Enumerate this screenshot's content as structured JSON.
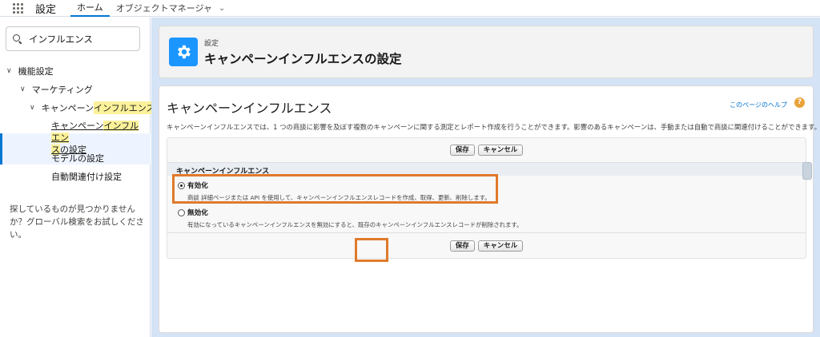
{
  "topbar": {
    "app_name": "設定",
    "tabs": [
      {
        "label": "ホーム"
      },
      {
        "label": "オブジェクトマネージャ"
      }
    ]
  },
  "sidebar": {
    "search_value": "インフルエンス",
    "tree": {
      "root": "機能設定",
      "marketing": "マーケティング",
      "campaign_influence_prefix": "キャンペーン",
      "campaign_influence_hl": "インフルエンス",
      "selected_prefix": "キャンペーン",
      "selected_hl1": "インフルエン",
      "selected_hl2": "ス",
      "selected_suffix": "の設定",
      "model_settings": "モデルの設定",
      "auto_link": "自動関連付け設定"
    },
    "help_text": "探しているものが見つかりませんか？グローバル検索をお試しください。"
  },
  "header": {
    "breadcrumb": "設定",
    "title": "キャンペーンインフルエンスの設定",
    "icon": "gear-icon"
  },
  "content": {
    "page_heading": "キャンペーンインフルエンス",
    "help_link": "このページのヘルプ",
    "help_icon": "?",
    "description": "キャンペーンインフルエンスでは、1 つの商談に影響を及ぼす複数のキャンペーンに関する測定とレポート作成を行うことができます。影響のあるキャンペーンは、手動または自動で商談に関連付けることができます。",
    "save_label": "保存",
    "cancel_label": "キャンセル",
    "section_title": "キャンペーンインフルエンス",
    "options": [
      {
        "label": "有効化",
        "desc": "商談 詳細ページまたは API を使用して、キャンペーンインフルエンスレコードを作成、取得、更新、削除します。",
        "checked": true
      },
      {
        "label": "無効化",
        "desc": "有効になっているキャンペーンインフルエンスを無効にすると、既存のキャンペーンインフルエンスレコードが削除されます。",
        "checked": false
      }
    ]
  },
  "colors": {
    "annotation": "#e07a2c",
    "accent": "#0176d3",
    "highlight": "#fbf19a"
  }
}
